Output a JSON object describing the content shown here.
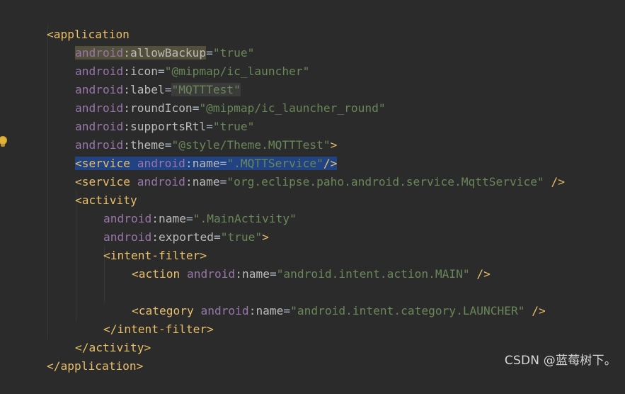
{
  "editor": {
    "lines": [
      {
        "tag_open": "<application"
      },
      {
        "ns": "android",
        "attr": "allowBackup",
        "value": "\"true\""
      },
      {
        "ns": "android",
        "attr": "icon",
        "value": "\"@mipmap/ic_launcher\""
      },
      {
        "ns": "android",
        "attr": "label",
        "value": "\"MQTTTest\""
      },
      {
        "ns": "android",
        "attr": "roundIcon",
        "value": "\"@mipmap/ic_launcher_round\""
      },
      {
        "ns": "android",
        "attr": "supportsRtl",
        "value": "\"true\""
      },
      {
        "ns": "android",
        "attr": "theme",
        "value": "\"@style/Theme.MQTTTest\"",
        "close": ">"
      },
      {
        "tag_open": "<service",
        "ns": "android",
        "attr": "name",
        "value": "\".MQTTService\"",
        "close": "/>"
      },
      {
        "tag_open": "<service",
        "ns": "android",
        "attr": "name",
        "value": "\"org.eclipse.paho.android.service.MqttService\"",
        "close": " />"
      },
      {
        "tag_open": "<activity"
      },
      {
        "ns": "android",
        "attr": "name",
        "value": "\".MainActivity\""
      },
      {
        "ns": "android",
        "attr": "exported",
        "value": "\"true\"",
        "close": ">"
      },
      {
        "tag_open": "<intent-filter>"
      },
      {
        "tag_open": "<action",
        "ns": "android",
        "attr": "name",
        "value": "\"android.intent.action.MAIN\"",
        "close": " />"
      },
      {
        "tag_open": "<category",
        "ns": "android",
        "attr": "name",
        "value": "\"android.intent.category.LAUNCHER\"",
        "close": " />"
      },
      {
        "tag_close": "</intent-filter>"
      },
      {
        "tag_close": "</activity>"
      },
      {
        "tag_close": "</application>"
      }
    ]
  },
  "colors": {
    "background": "#2b2b2b",
    "tag": "#e8bf6a",
    "namespace": "#9876aa",
    "attribute": "#bababa",
    "value": "#6a8759",
    "selection": "#214283"
  },
  "icons": {
    "gutter": "lightbulb-icon"
  },
  "watermark": "CSDN @蓝莓树下。"
}
